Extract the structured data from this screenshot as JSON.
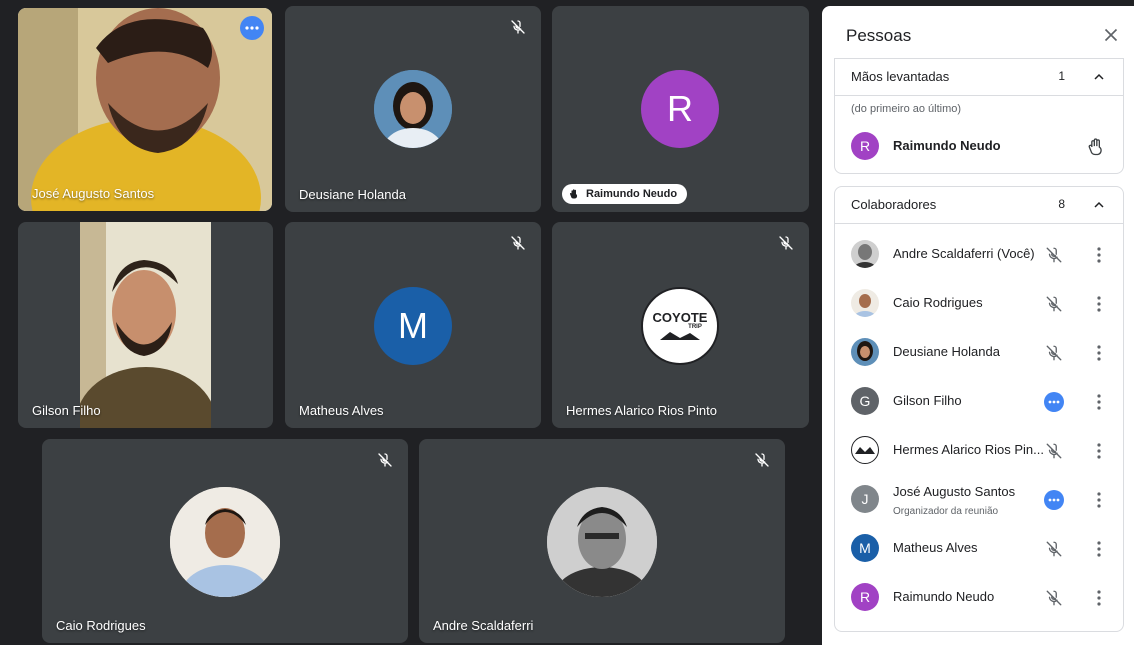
{
  "tiles": [
    {
      "name": "José Augusto Santos",
      "kind": "video",
      "active": true,
      "more": true
    },
    {
      "name": "Deusiane Holanda",
      "kind": "avatar-photo",
      "muted": true
    },
    {
      "name": "Raimundo Neudo",
      "kind": "letter",
      "letter": "R",
      "color": "#a142c4",
      "hand": true
    },
    {
      "name": "Gilson Filho",
      "kind": "video"
    },
    {
      "name": "Matheus Alves",
      "kind": "letter",
      "letter": "M",
      "color": "#1a5fa8",
      "muted": true
    },
    {
      "name": "Hermes Alarico Rios Pinto",
      "kind": "logo",
      "muted": true,
      "logo_main": "COYOTE",
      "logo_sub": "TRIP"
    },
    {
      "name": "Caio Rodrigues",
      "kind": "avatar-photo",
      "muted": true
    },
    {
      "name": "Andre Scaldaferri",
      "kind": "avatar-photo",
      "muted": true
    }
  ],
  "panel": {
    "title": "Pessoas",
    "raised": {
      "title": "Mãos levantadas",
      "count": "1",
      "hint": "(do primeiro ao último)",
      "person": {
        "name": "Raimundo Neudo",
        "letter": "R",
        "color": "#a142c4"
      }
    },
    "collab": {
      "title": "Colaboradores",
      "count": "8",
      "people": [
        {
          "name": "Andre Scaldaferri (Você)",
          "type": "photo",
          "status": "muted"
        },
        {
          "name": "Caio Rodrigues",
          "type": "photo",
          "status": "muted"
        },
        {
          "name": "Deusiane Holanda",
          "type": "photo",
          "status": "muted"
        },
        {
          "name": "Gilson Filho",
          "type": "letter",
          "letter": "G",
          "color": "#5f6368",
          "status": "more"
        },
        {
          "name": "Hermes Alarico Rios Pin...",
          "type": "logo",
          "status": "muted"
        },
        {
          "name": "José Augusto Santos",
          "sub": "Organizador da reunião",
          "type": "letter",
          "letter": "J",
          "color": "#80868b",
          "status": "more"
        },
        {
          "name": "Matheus Alves",
          "type": "letter",
          "letter": "M",
          "color": "#1a5fa8",
          "status": "muted"
        },
        {
          "name": "Raimundo Neudo",
          "type": "letter",
          "letter": "R",
          "color": "#a142c4",
          "status": "muted"
        }
      ]
    }
  }
}
